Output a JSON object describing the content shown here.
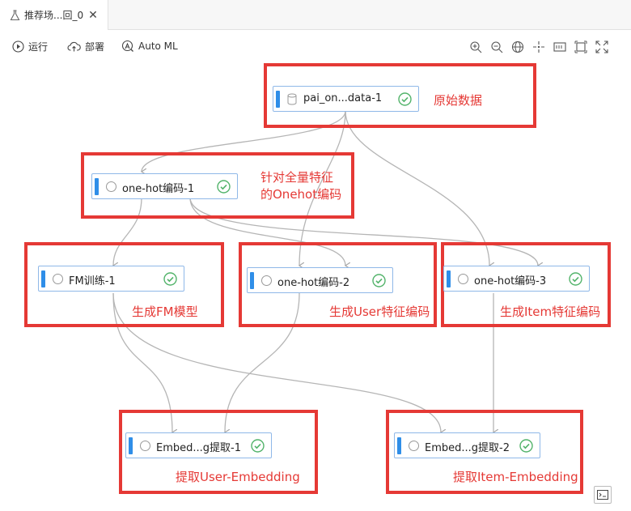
{
  "tab": {
    "title": "推荐场...回_0",
    "close": "✕"
  },
  "toolbar": {
    "run": "运行",
    "deploy": "部署",
    "automl": "Auto ML"
  },
  "nodes": {
    "n1": "pai_on...data-1",
    "n2": "one-hot编码-1",
    "n3": "FM训练-1",
    "n4": "one-hot编码-2",
    "n5": "one-hot编码-3",
    "n6": "Embed...g提取-1",
    "n7": "Embed...g提取-2"
  },
  "annotations": {
    "a1": "原始数据",
    "a2_line1": "针对全量特征",
    "a2_line2": "的Onehot编码",
    "a3": "生成FM模型",
    "a4": "生成User特征编码",
    "a5": "生成Item特征编码",
    "a6": "提取User-Embedding",
    "a7": "提取Item-Embedding"
  },
  "colors": {
    "annotation": "#e53935",
    "node_bar": "#2f8ee8",
    "success": "#52b36a",
    "edge": "#b5b5b5"
  }
}
